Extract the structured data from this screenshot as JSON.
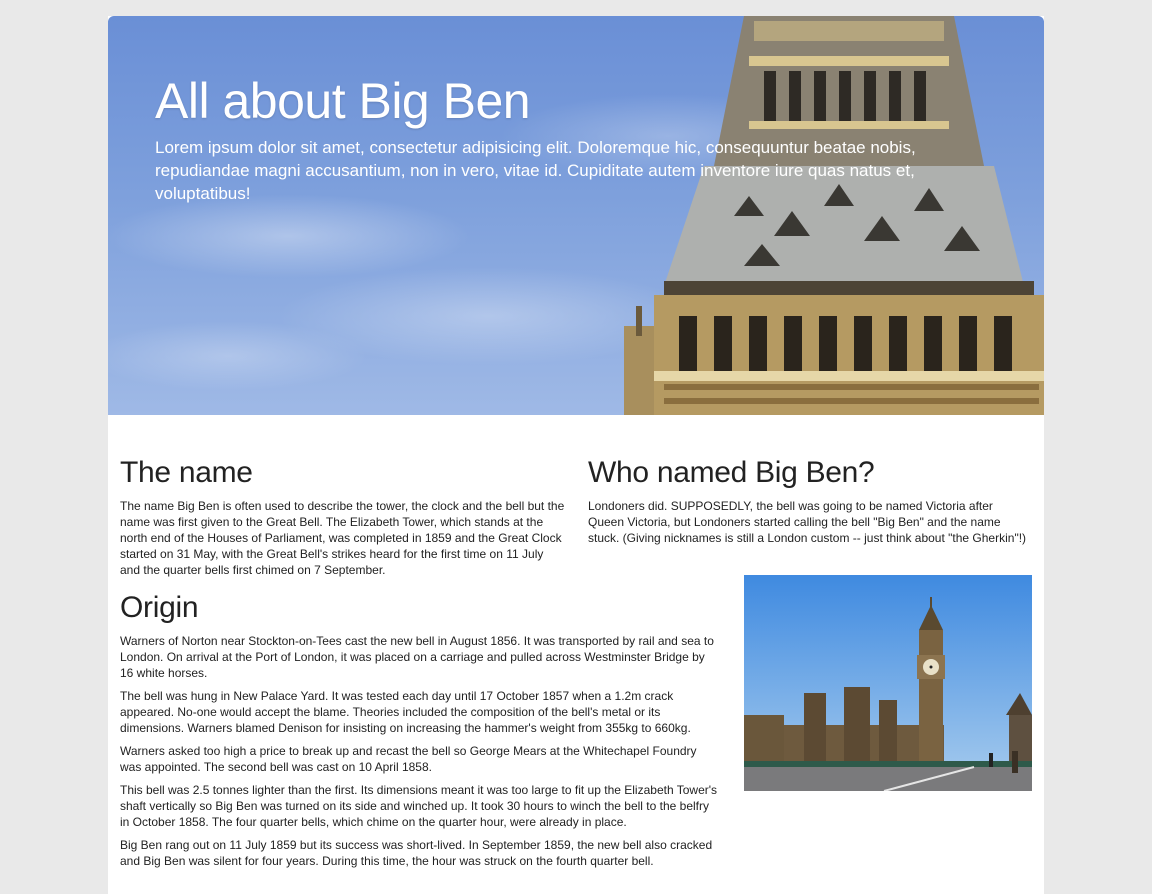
{
  "hero": {
    "title": "All about Big Ben",
    "lead": "Lorem ipsum dolor sit amet, consectetur adipisicing elit. Doloremque hic, consequuntur beatae nobis, repudiandae magni accusantium, non in vero, vitae id. Cupiditate autem inventore iure quas natus et, voluptatibus!"
  },
  "sections": {
    "name": {
      "heading": "The name",
      "body": "The name Big Ben is often used to describe the tower, the clock and the bell but the name was first given to the Great Bell. The Elizabeth Tower, which stands at the north end of the Houses of Parliament, was completed in 1859 and the Great Clock started on 31 May, with the Great Bell's strikes heard for the first time on 11 July and the quarter bells first chimed on 7 September."
    },
    "who": {
      "heading": "Who named Big Ben?",
      "body": "Londoners did. SUPPOSEDLY, the bell was going to be named Victoria after Queen Victoria, but Londoners started calling the bell \"Big Ben\" and the name stuck. (Giving nicknames is still a London custom -- just think about \"the Gherkin\"!)"
    },
    "origin": {
      "heading": "Origin",
      "paragraphs": [
        "Warners of Norton near Stockton-on-Tees cast the new bell in August 1856. It was transported by rail and sea to London. On arrival at the Port of London, it was placed on a carriage and pulled across Westminster Bridge by 16 white horses.",
        "The bell was hung in New Palace Yard. It was tested each day until 17 October 1857 when a 1.2m crack appeared. No-one would accept the blame. Theories included the composition of the bell's metal or its dimensions. Warners blamed Denison for insisting on increasing the hammer's weight from 355kg to 660kg.",
        "Warners asked too high a price to break up and recast the bell so George Mears at the Whitechapel Foundry was appointed. The second bell was cast on 10 April 1858.",
        "This bell was 2.5 tonnes lighter than the first. Its dimensions meant it was too large to fit up the Elizabeth Tower's shaft vertically so Big Ben was turned on its side and winched up. It took 30 hours to winch the bell to the belfry in October 1858. The four quarter bells, which chime on the quarter hour, were already in place.",
        "Big Ben rang out on 11 July 1859 but its success was short-lived. In September 1859, the new bell also cracked and Big Ben was silent for four years. During this time, the hour was struck on the fourth quarter bell."
      ]
    }
  },
  "colors": {
    "page_bg": "#e9e9e9",
    "sky": "#6a8fd6",
    "text": "#222222"
  }
}
